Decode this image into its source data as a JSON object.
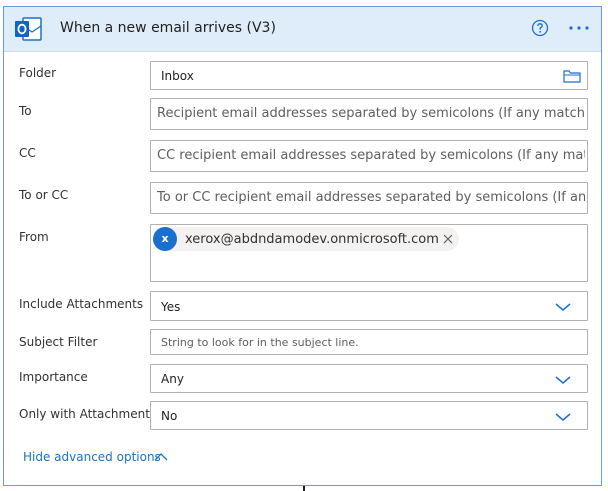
{
  "header": {
    "title": "When a new email arrives (V3)",
    "logo_icon": "outlook-icon",
    "help_icon": "help-circle-icon",
    "more_icon": "more-ellipsis-icon"
  },
  "fields": {
    "folder": {
      "label": "Folder",
      "value": "Inbox",
      "icon": "folder-icon"
    },
    "to": {
      "label": "To",
      "placeholder": "Recipient email addresses separated by semicolons (If any match, the"
    },
    "cc": {
      "label": "CC",
      "placeholder": "CC recipient email addresses separated by semicolons (If any match,"
    },
    "to_or_cc": {
      "label": "To or CC",
      "placeholder": "To or CC recipient email addresses separated by semicolons (If any m"
    },
    "from": {
      "label": "From",
      "token": {
        "initial": "x",
        "email": "xerox@abdndamodev.onmicrosoft.com",
        "remove_icon": "close-icon"
      }
    },
    "include_attachments": {
      "label": "Include Attachments",
      "value": "Yes"
    },
    "subject_filter": {
      "label": "Subject Filter",
      "placeholder": "String to look for in the subject line."
    },
    "importance": {
      "label": "Importance",
      "value": "Any"
    },
    "only_with_attachments": {
      "label": "Only with Attachments",
      "value": "No"
    }
  },
  "footer": {
    "advanced_label": "Hide advanced options",
    "advanced_icon": "chevron-up-icon"
  },
  "colors": {
    "header_bg": "#deedf9",
    "accent": "#1a73c8",
    "border": "#6a9bd8"
  }
}
